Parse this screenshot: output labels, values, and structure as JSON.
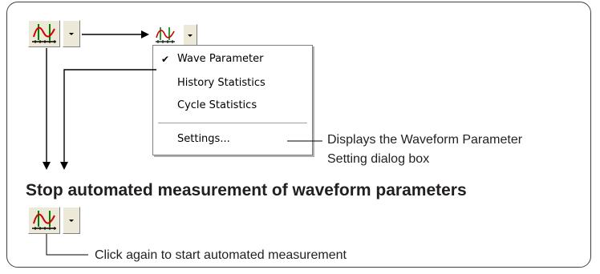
{
  "menu": {
    "items": [
      {
        "label": "Wave Parameter",
        "checked": true
      },
      {
        "label": "History Statistics",
        "checked": false
      },
      {
        "label": "Cycle Statistics",
        "checked": false
      }
    ],
    "settings_label": "Settings...",
    "check_glyph": "✔"
  },
  "annotations": {
    "settings_note_line1": "Displays the Waveform Parameter",
    "settings_note_line2": "Setting dialog box",
    "heading": "Stop automated measurement of waveform parameters",
    "click_note": "Click again to start automated measurement"
  },
  "icons": {
    "main_icon": "waveform-parameter-icon",
    "dropdown_icon": "dropdown-arrow-icon",
    "check_icon": "checkmark-icon"
  },
  "colors": {
    "wave": "#cc0000",
    "cursor": "#008000",
    "arrow": "#000000",
    "frame": "#404040"
  }
}
